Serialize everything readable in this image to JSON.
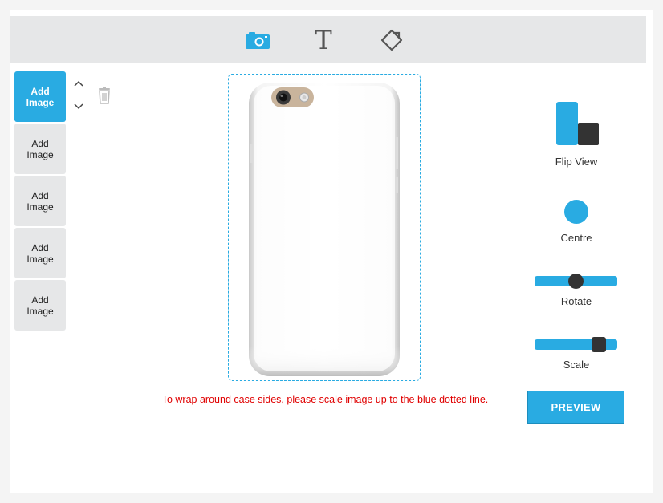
{
  "toolbar": {
    "tools": [
      {
        "icon": "camera-icon",
        "active": true
      },
      {
        "icon": "text-icon",
        "glyph": "T"
      },
      {
        "icon": "tag-icon"
      }
    ]
  },
  "image_slots": [
    {
      "label": "Add Image",
      "active": true
    },
    {
      "label": "Add Image",
      "active": false
    },
    {
      "label": "Add Image",
      "active": false
    },
    {
      "label": "Add Image",
      "active": false
    },
    {
      "label": "Add Image",
      "active": false
    }
  ],
  "icons": {
    "move_up": "chevron-up-icon",
    "move_down": "chevron-down-icon",
    "delete": "trash-icon",
    "flip_view": "flip-view-icon",
    "centre": "centre-icon"
  },
  "notice": "To wrap around case sides, please scale image up to the blue dotted line.",
  "controls": {
    "flip_view_label": "Flip View",
    "centre_label": "Centre",
    "rotate_label": "Rotate",
    "rotate_value": 0.5,
    "scale_label": "Scale",
    "scale_value": 0.8
  },
  "preview_label": "PREVIEW",
  "colors": {
    "accent": "#29abe2",
    "notice": "#e00000",
    "toolbar_bg": "#e6e7e8"
  }
}
